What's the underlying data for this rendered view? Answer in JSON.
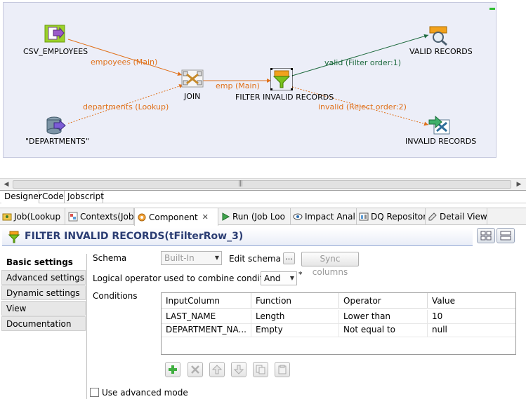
{
  "designer": {
    "nodes": {
      "csv_employees": "CSV_EMPLOYEES",
      "departments": "\"DEPARTMENTS\"",
      "join": "JOIN",
      "filter": "FILTER INVALID RECORDS",
      "valid": "VALID RECORDS",
      "invalid": "INVALID RECORDS"
    },
    "links": {
      "employees_main": "empoyees (Main)",
      "departments_lookup": "departments (Lookup)",
      "emp_main": "emp (Main)",
      "valid_filter": "valid (Filter order:1)",
      "invalid_reject": "invalid (Reject order:2)"
    },
    "colors": {
      "main_link": "#e0701a",
      "valid_link": "#1f6b3f",
      "canvas": "#eceef8"
    }
  },
  "editor_tabs": [
    "Designer",
    "Code",
    "Jobscript"
  ],
  "view_tabs": [
    {
      "label": "Job(Lookup",
      "icon": "job-icon"
    },
    {
      "label": "Contexts(Job",
      "icon": "contexts-icon"
    },
    {
      "label": "Component",
      "icon": "component-icon",
      "close": "✕"
    },
    {
      "label": "Run (Job Loo",
      "icon": "run-icon"
    },
    {
      "label": "Impact Anal",
      "icon": "impact-icon"
    },
    {
      "label": "DQ Repositor",
      "icon": "dq-repository-icon"
    },
    {
      "label": "Detail View",
      "icon": "detail-view-icon"
    }
  ],
  "component": {
    "title": "FILTER INVALID RECORDS(tFilterRow_3)"
  },
  "nav": [
    "Basic settings",
    "Advanced settings",
    "Dynamic settings",
    "View",
    "Documentation"
  ],
  "form": {
    "schema_label": "Schema",
    "schema_value": "Built-In",
    "edit_schema_label": "Edit schema",
    "edit_schema_button": "...",
    "sync_columns": "Sync columns",
    "logical_label": "Logical operator used to combine conditions",
    "logical_value": "And",
    "required_mark": "*",
    "conditions_label": "Conditions",
    "use_advanced_mode": "Use advanced mode"
  },
  "table": {
    "headers": [
      "InputColumn",
      "Function",
      "Operator",
      "Value"
    ],
    "rows": [
      [
        "LAST_NAME",
        "Length",
        "Lower than",
        "10"
      ],
      [
        "DEPARTMENT_NA...",
        "Empty",
        "Not equal to",
        "null"
      ]
    ]
  }
}
